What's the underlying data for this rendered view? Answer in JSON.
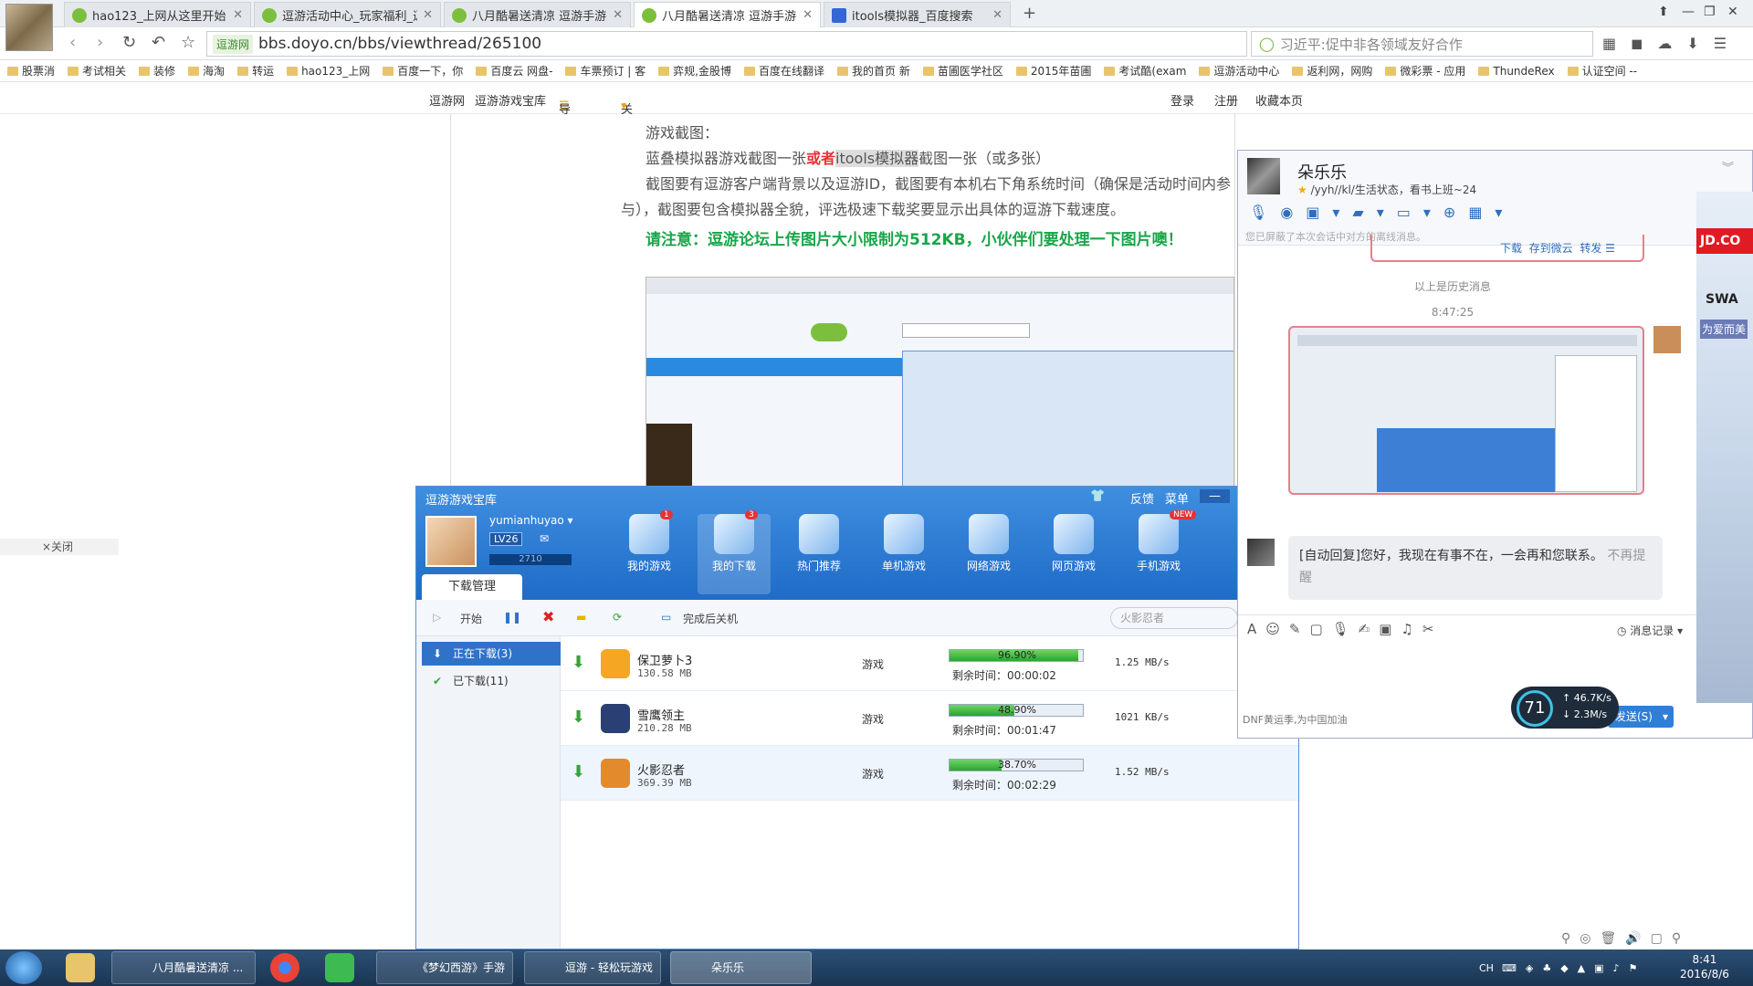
{
  "browser": {
    "tabs": [
      {
        "label": "hao123_上网从这里开始"
      },
      {
        "label": "逗游活动中心_玩家福利_逗游"
      },
      {
        "label": "八月酷暑送清凉 逗游手游来"
      },
      {
        "label": "八月酷暑送清凉 逗游手游来"
      },
      {
        "label": "itools模拟器_百度搜索"
      }
    ],
    "site_badge": "逗游网",
    "url": "bbs.doyo.cn/bbs/viewthread/265100",
    "search_placeholder": "习近平:促中非各领域友好合作",
    "bookmarks": [
      "股票消",
      "考试相关",
      "装修",
      "海淘",
      "转运",
      "hao123_上网",
      "百度一下，你",
      "百度云 网盘-",
      "车票预订 | 客",
      "弈规,金股博",
      "百度在线翻译",
      "我的首页 新",
      "苗圃医学社区",
      "2015年苗圃",
      "考试酷(exam",
      "逗游活动中心",
      "返利网，网购",
      "微彩票 - 应用",
      "ThundeRex",
      "认证空间 --"
    ]
  },
  "sitebar": {
    "items": [
      "逗游网",
      "逗游游戏宝库",
      "导航",
      "关注逗游"
    ],
    "login": "登录",
    "register": "注册",
    "favorite": "收藏本页"
  },
  "article": {
    "line1": "游戏截图：",
    "line2a": "蓝叠模拟器游戏截图一张",
    "line2b": "或者",
    "line2c": "itools模拟器",
    "line2d": "截图一张（或多张）",
    "line3": "截图要有逗游客户端背景以及逗游ID，截图要有本机右下角系统时间（确保是活动时间内参与），截图要包含模拟器全貌，评选极速下载奖要显示出具体的逗游下载速度。",
    "warning": "请注意：逗游论坛上传图片大小限制为512KB，小伙伴们要处理一下图片噢！",
    "close": "×关闭"
  },
  "download_manager": {
    "title": "逗游游戏宝库",
    "feedback": "反馈",
    "menu": "菜单",
    "username": "yumianhuyao",
    "level": "LV26",
    "points": "2710",
    "nav": [
      {
        "label": "我的游戏",
        "badge": "1"
      },
      {
        "label": "我的下载",
        "badge": "3"
      },
      {
        "label": "热门推荐",
        "badge": ""
      },
      {
        "label": "单机游戏",
        "badge": ""
      },
      {
        "label": "网络游戏",
        "badge": ""
      },
      {
        "label": "网页游戏",
        "badge": ""
      },
      {
        "label": "手机游戏",
        "badge": "NEW"
      }
    ],
    "tab": "下载管理",
    "toolbar": {
      "start": "开始",
      "shutdown": "完成后关机",
      "search_placeholder": "火影忍者"
    },
    "side": [
      {
        "label": "正在下载(3)"
      },
      {
        "label": "已下载(11)"
      }
    ],
    "rows": [
      {
        "name": "保卫萝卜3",
        "size": "130.58 MB",
        "type": "游戏",
        "progress_label": "96.90%",
        "progress": 96.9,
        "remaining": "剩余时间：00:00:02",
        "speed": "1.25 MB/s",
        "icon_color": "#f5a623"
      },
      {
        "name": "雪鹰领主",
        "size": "210.28 MB",
        "type": "游戏",
        "progress_label": "48.90%",
        "progress": 48.9,
        "remaining": "剩余时间：00:01:47",
        "speed": "1021 KB/s",
        "icon_color": "#2a3f73"
      },
      {
        "name": "火影忍者",
        "size": "369.39 MB",
        "type": "游戏",
        "progress_label": "38.70%",
        "progress": 38.7,
        "remaining": "剩余时间：00:02:29",
        "speed": "1.52 MB/s",
        "icon_color": "#e38b2c"
      }
    ]
  },
  "chat": {
    "name": "朵乐乐",
    "status": "/yyh//kl/生活状态，看书上班~24",
    "notice": "您已屏蔽了本次会话中对方的离线消息。",
    "file_actions": [
      "下载",
      "存到微云",
      "转发"
    ],
    "history": "以上是历史消息",
    "time": "8:47:25",
    "auto_reply": "[自动回复]您好，我现在有事不在，一会再和您联系。",
    "no_remind": "不再提醒",
    "msg_record": "消息记录",
    "footer": "DNF黄运季,为中国加油",
    "send": "发送(S)"
  },
  "widget": {
    "percent": "71",
    "up": "46.7K/s",
    "down": "2.3M/s"
  },
  "ad": {
    "brand": "JD.CO",
    "promo": "为爱而美",
    "logo_text": "SWA"
  },
  "taskbar": {
    "items": [
      "八月酷暑送清凉 ...",
      "《梦幻西游》手游",
      "逗游 - 轻松玩游戏",
      "朵乐乐"
    ],
    "time": "8:41",
    "date": "2016/8/6",
    "lang": "CH"
  }
}
